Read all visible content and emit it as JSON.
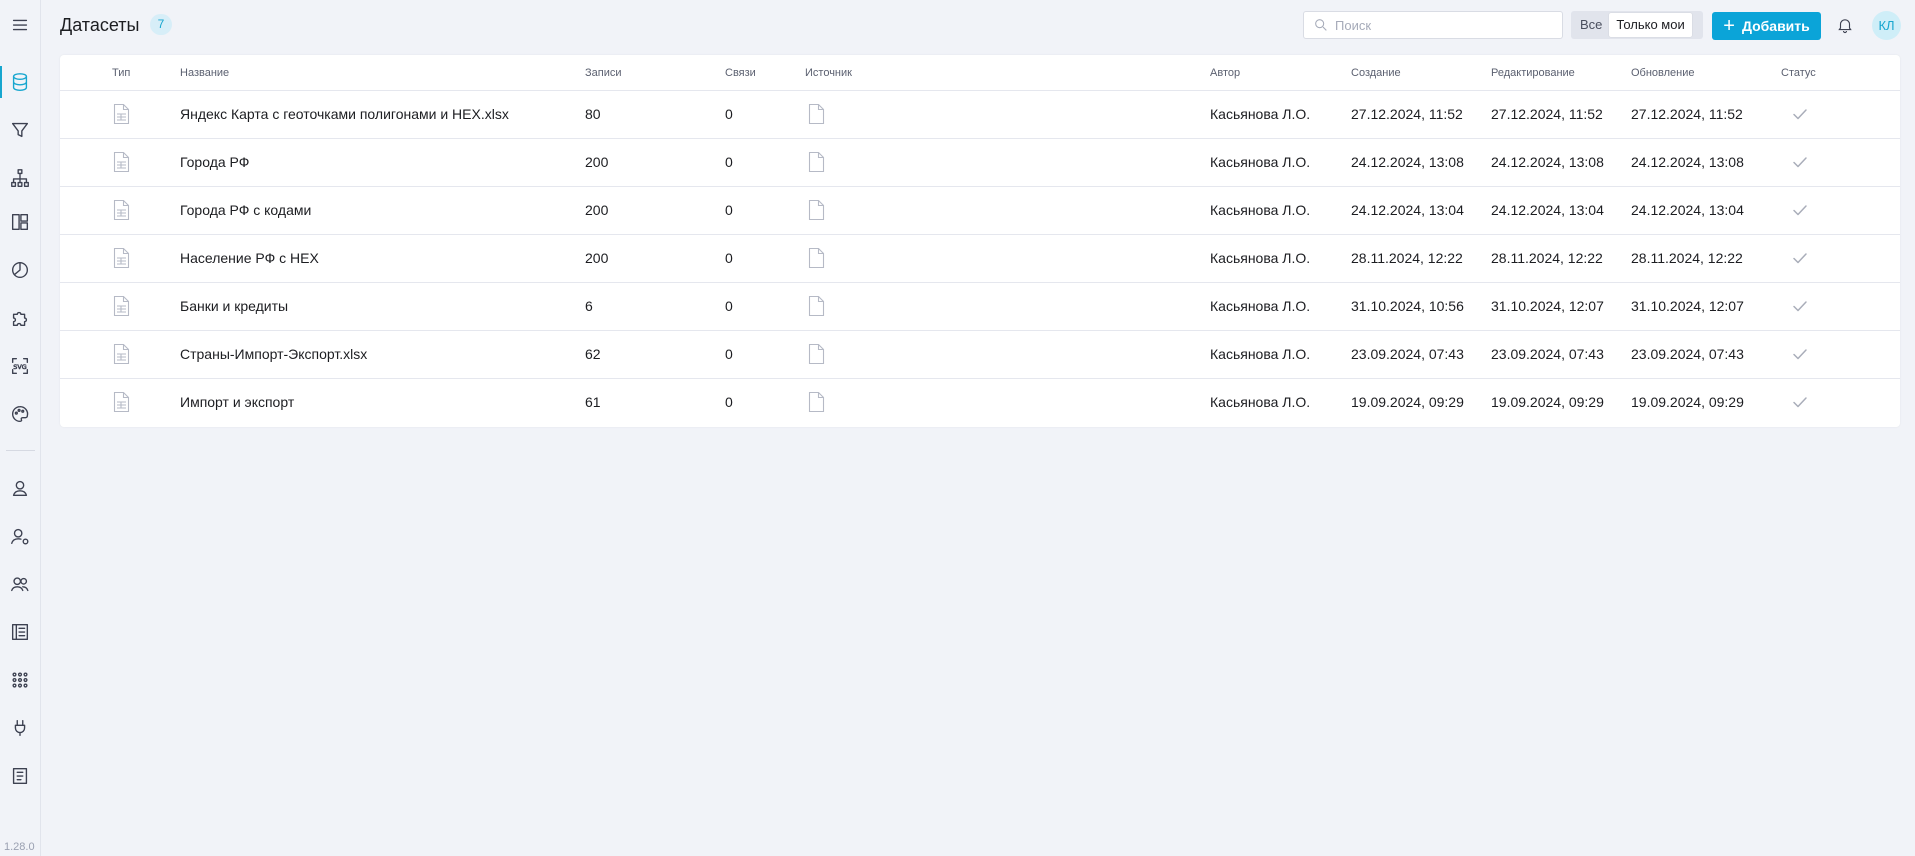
{
  "sidebar": {
    "items": [
      {
        "icon": "menu-icon"
      },
      {
        "icon": "database-icon",
        "active": true
      },
      {
        "icon": "filter-icon"
      },
      {
        "icon": "hierarchy-icon"
      },
      {
        "icon": "dashboard-icon"
      },
      {
        "icon": "pie-chart-icon"
      },
      {
        "icon": "puzzle-icon"
      },
      {
        "icon": "svg-icon"
      },
      {
        "icon": "palette-icon"
      },
      {
        "icon": "user-icon"
      },
      {
        "icon": "user-settings-icon"
      },
      {
        "icon": "users-icon"
      },
      {
        "icon": "journal-icon"
      },
      {
        "icon": "apps-grid-icon"
      },
      {
        "icon": "plug-icon"
      },
      {
        "icon": "notes-icon"
      }
    ],
    "version": "1.28.0"
  },
  "header": {
    "title": "Датасеты",
    "count": "7",
    "search_placeholder": "Поиск",
    "filter_all": "Все",
    "filter_mine": "Только мои",
    "add_label": "Добавить",
    "avatar_initials": "КЛ"
  },
  "table": {
    "columns": {
      "type": "Тип",
      "name": "Название",
      "records": "Записи",
      "links": "Связи",
      "source": "Источник",
      "author": "Автор",
      "created": "Создание",
      "edited": "Редактирование",
      "updated": "Обновление",
      "status": "Статус"
    },
    "rows": [
      {
        "name": "Яндекс Карта с геоточками полигонами и HEX.xlsx",
        "records": "80",
        "links": "0",
        "author": "Касьянова Л.О.",
        "created": "27.12.2024, 11:52",
        "edited": "27.12.2024, 11:52",
        "updated": "27.12.2024, 11:52"
      },
      {
        "name": "Города РФ",
        "records": "200",
        "links": "0",
        "author": "Касьянова Л.О.",
        "created": "24.12.2024, 13:08",
        "edited": "24.12.2024, 13:08",
        "updated": "24.12.2024, 13:08"
      },
      {
        "name": "Города РФ с кодами",
        "records": "200",
        "links": "0",
        "author": "Касьянова Л.О.",
        "created": "24.12.2024, 13:04",
        "edited": "24.12.2024, 13:04",
        "updated": "24.12.2024, 13:04"
      },
      {
        "name": "Население РФ с HEX",
        "records": "200",
        "links": "0",
        "author": "Касьянова Л.О.",
        "created": "28.11.2024, 12:22",
        "edited": "28.11.2024, 12:22",
        "updated": "28.11.2024, 12:22"
      },
      {
        "name": "Банки и кредиты",
        "records": "6",
        "links": "0",
        "author": "Касьянова Л.О.",
        "created": "31.10.2024, 10:56",
        "edited": "31.10.2024, 12:07",
        "updated": "31.10.2024, 12:07"
      },
      {
        "name": "Страны-Импорт-Экспорт.xlsx",
        "records": "62",
        "links": "0",
        "author": "Касьянова Л.О.",
        "created": "23.09.2024, 07:43",
        "edited": "23.09.2024, 07:43",
        "updated": "23.09.2024, 07:43"
      },
      {
        "name": "Импорт и экспорт",
        "records": "61",
        "links": "0",
        "author": "Касьянова Л.О.",
        "created": "19.09.2024, 09:29",
        "edited": "19.09.2024, 09:29",
        "updated": "19.09.2024, 09:29"
      }
    ]
  },
  "colors": {
    "accent": "#0ba4d8",
    "background": "#f1f3f8"
  }
}
